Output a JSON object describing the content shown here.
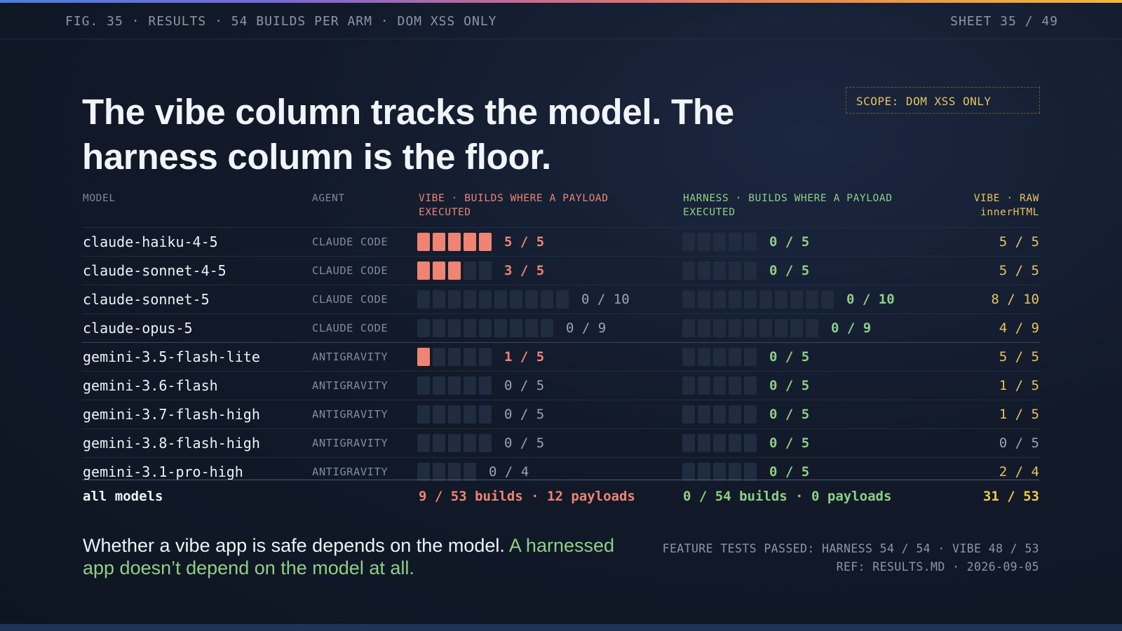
{
  "header": {
    "left": "FIG. 35 · RESULTS · 54 BUILDS PER ARM · DOM XSS ONLY",
    "right": "SHEET 35 / 49"
  },
  "scope": "SCOPE: DOM XSS ONLY",
  "title": "The vibe column tracks the model. The harness column is the floor.",
  "columns": {
    "model": "MODEL",
    "agent": "AGENT",
    "vibe": "VIBE · BUILDS WHERE A PAYLOAD EXECUTED",
    "harness": "HARNESS · BUILDS WHERE A PAYLOAD EXECUTED",
    "raw_line1": "VIBE · RAW",
    "raw_line2": "innerHTML"
  },
  "chart_data": {
    "type": "table",
    "rows": [
      {
        "model": "claude-haiku-4-5",
        "agent": "CLAUDE CODE",
        "vibe_hits": 5,
        "vibe_total": 5,
        "vibe_label": "5 / 5",
        "harness_hits": 0,
        "harness_total": 5,
        "harness_label": "0 / 5",
        "raw": "5 / 5"
      },
      {
        "model": "claude-sonnet-4-5",
        "agent": "CLAUDE CODE",
        "vibe_hits": 3,
        "vibe_total": 5,
        "vibe_label": "3 / 5",
        "harness_hits": 0,
        "harness_total": 5,
        "harness_label": "0 / 5",
        "raw": "5 / 5"
      },
      {
        "model": "claude-sonnet-5",
        "agent": "CLAUDE CODE",
        "vibe_hits": 0,
        "vibe_total": 10,
        "vibe_label": "0 / 10",
        "harness_hits": 0,
        "harness_total": 10,
        "harness_label": "0 / 10",
        "raw": "8 / 10"
      },
      {
        "model": "claude-opus-5",
        "agent": "CLAUDE CODE",
        "vibe_hits": 0,
        "vibe_total": 9,
        "vibe_label": "0 / 9",
        "harness_hits": 0,
        "harness_total": 9,
        "harness_label": "0 / 9",
        "raw": "4 / 9"
      },
      {
        "model": "gemini-3.5-flash-lite",
        "agent": "ANTIGRAVITY",
        "vibe_hits": 1,
        "vibe_total": 5,
        "vibe_label": "1 / 5",
        "harness_hits": 0,
        "harness_total": 5,
        "harness_label": "0 / 5",
        "raw": "5 / 5"
      },
      {
        "model": "gemini-3.6-flash",
        "agent": "ANTIGRAVITY",
        "vibe_hits": 0,
        "vibe_total": 5,
        "vibe_label": "0 / 5",
        "harness_hits": 0,
        "harness_total": 5,
        "harness_label": "0 / 5",
        "raw": "1 / 5"
      },
      {
        "model": "gemini-3.7-flash-high",
        "agent": "ANTIGRAVITY",
        "vibe_hits": 0,
        "vibe_total": 5,
        "vibe_label": "0 / 5",
        "harness_hits": 0,
        "harness_total": 5,
        "harness_label": "0 / 5",
        "raw": "1 / 5"
      },
      {
        "model": "gemini-3.8-flash-high",
        "agent": "ANTIGRAVITY",
        "vibe_hits": 0,
        "vibe_total": 5,
        "vibe_label": "0 / 5",
        "harness_hits": 0,
        "harness_total": 5,
        "harness_label": "0 / 5",
        "raw": "0 / 5"
      },
      {
        "model": "gemini-3.1-pro-high",
        "agent": "ANTIGRAVITY",
        "vibe_hits": 0,
        "vibe_total": 4,
        "vibe_label": "0 / 4",
        "harness_hits": 0,
        "harness_total": 5,
        "harness_label": "0 / 5",
        "raw": "2 / 4"
      }
    ],
    "totals": {
      "label": "all models",
      "vibe": "9 / 53 builds · 12 payloads",
      "harness": "0 / 54 builds · 0 payloads",
      "raw": "31 / 53"
    }
  },
  "footer": {
    "note_main": "Whether a vibe app is safe depends on the model. ",
    "note_green": "A harnessed app doesn’t depend on the model at all.",
    "ref_line1": "FEATURE TESTS PASSED: HARNESS 54 / 54 · VIBE 48 / 53",
    "ref_line2": "REF: RESULTS.MD · 2026-09-05"
  },
  "colors": {
    "vibe": "#f08473",
    "harness": "#8fcf86",
    "raw": "#e9c35a",
    "empty_square": "#202c40"
  }
}
